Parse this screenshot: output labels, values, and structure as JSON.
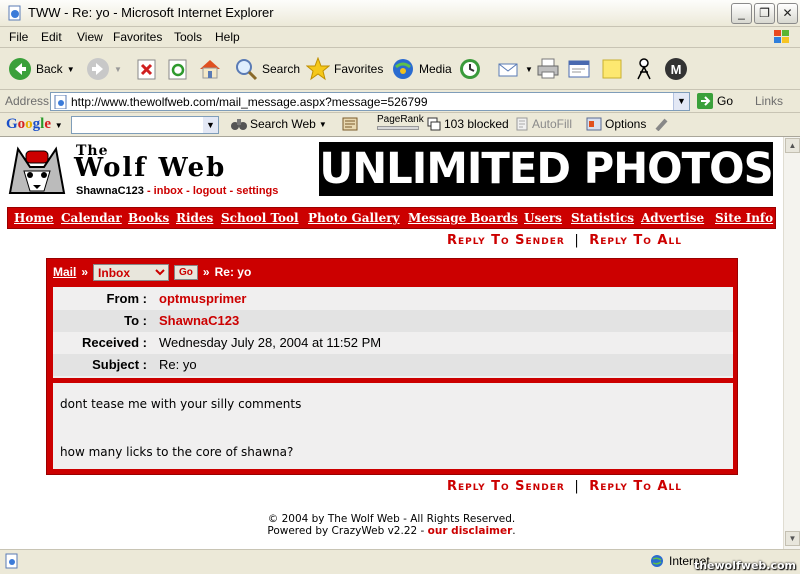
{
  "window": {
    "title": "TWW - Re: yo - Microsoft Internet Explorer",
    "minimize": "_",
    "restore": "❐",
    "close": "✕"
  },
  "menu": [
    "File",
    "Edit",
    "View",
    "Favorites",
    "Tools",
    "Help"
  ],
  "toolbar": {
    "back": "Back",
    "search": "Search",
    "favorites": "Favorites",
    "media": "Media"
  },
  "address": {
    "label": "Address",
    "url": "http://www.thewolfweb.com/mail_message.aspx?message=526799",
    "go": "Go",
    "links": "Links"
  },
  "googlebar": {
    "logo": "Google",
    "search_web": "Search Web",
    "pagerank": "PageRank",
    "blocked": "103 blocked",
    "autofill": "AutoFill",
    "options": "Options"
  },
  "site": {
    "title_the": "The",
    "title": "Wolf Web",
    "username": "ShawnaC123",
    "user_links": [
      "inbox",
      "logout",
      "settings"
    ],
    "banner": "UNLIMITED PHOTOS"
  },
  "nav": [
    "Home",
    "Calendar",
    "Books",
    "Rides",
    "School Tool",
    "Photo Gallery",
    "Message Boards",
    "Users",
    "Statistics",
    "Advertise",
    "Site Info"
  ],
  "reply": {
    "sender": "Reply To Sender",
    "all": "Reply To All",
    "separator": "|"
  },
  "mail": {
    "breadcrumb_mail": "Mail",
    "breadcrumb_sep": "»",
    "folder": "Inbox",
    "go": "Go",
    "subject_crumb": "Re: yo",
    "headers": [
      {
        "label": "From :",
        "value": "optmusprimer",
        "style": "link"
      },
      {
        "label": "To :",
        "value": "ShawnaC123",
        "style": "link"
      },
      {
        "label": "Received :",
        "value": "Wednesday July 28, 2004 at 11:52 PM",
        "style": "plain"
      },
      {
        "label": "Subject :",
        "value": "Re: yo",
        "style": "plain"
      }
    ],
    "body": [
      "dont tease me with your silly comments",
      "how many licks to the core of shawna?"
    ]
  },
  "footer": {
    "copyright": "© 2004 by The Wolf Web - All Rights Reserved.",
    "powered": "Powered by CrazyWeb v2.22 - ",
    "disclaimer": "our disclaimer",
    "disclaimer_end": "."
  },
  "status": {
    "zone": "Internet",
    "watermark": "thewolfweb.com"
  },
  "colors": {
    "brand_red": "#cc0000",
    "xp_chrome": "#ece9d8"
  }
}
